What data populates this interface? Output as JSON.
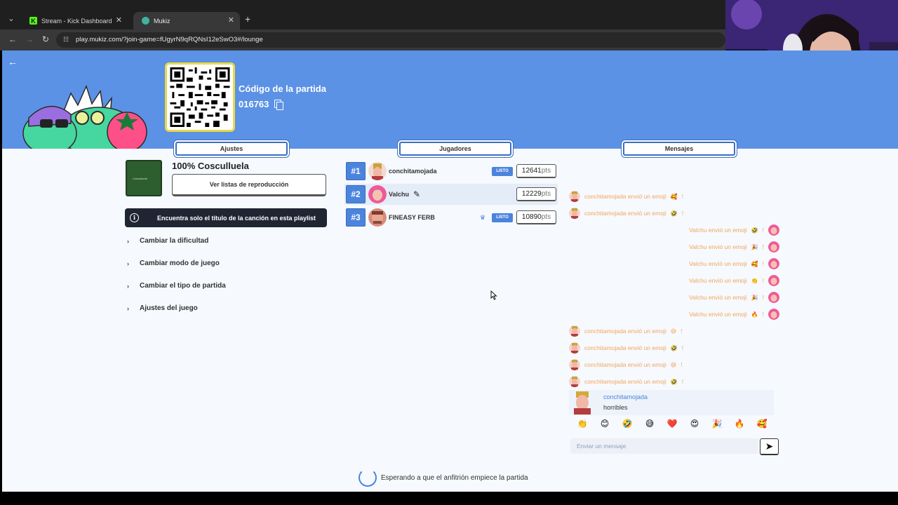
{
  "browser": {
    "tabs": [
      {
        "title": "Stream - Kick Dashboard",
        "favicon": "kick-icon",
        "active": false
      },
      {
        "title": "Mukiz",
        "favicon": "mukiz-icon",
        "active": true
      }
    ],
    "url": "play.mukiz.com/?join-game=fUgyrN9qRQNsI12eSwO3#/lounge"
  },
  "header": {
    "code_title": "Código de la partida",
    "code": "016763"
  },
  "sections": {
    "settings": "Ajustes",
    "players": "Jugadores",
    "messages": "Mensajes"
  },
  "settings": {
    "playlist_title": "100% Cosculluela",
    "playlist_cover_text": "Cosculluela",
    "view_playlists": "Ver listas de reproducción",
    "info": "Encuentra solo el título de la canción en esta playlist",
    "options": [
      "Cambiar la dificultad",
      "Cambiar modo de juego",
      "Cambiar el tipo de partida",
      "Ajustes del juego"
    ]
  },
  "players": [
    {
      "rank": "#1",
      "name": "conchitamojada",
      "ready": "LISTO",
      "points": "12641",
      "unit": "pts",
      "host": false,
      "me": false
    },
    {
      "rank": "#2",
      "name": "Valchu",
      "ready": "",
      "points": "12229",
      "unit": "pts",
      "host": false,
      "me": true
    },
    {
      "rank": "#3",
      "name": "FINEASY FERB",
      "ready": "LISTO",
      "points": "10890",
      "unit": "pts",
      "host": true,
      "me": false
    }
  ],
  "chat": {
    "events": [
      {
        "side": "left",
        "prefix": "conchitamojada envió un emoji",
        "emoji": "🥰",
        "suffix": "!"
      },
      {
        "side": "left",
        "prefix": "conchitamojada envió un emoji",
        "emoji": "🤣",
        "suffix": "!"
      },
      {
        "side": "right",
        "prefix": "Valchu envió un emoji",
        "emoji": "🤣",
        "suffix": "!"
      },
      {
        "side": "right",
        "prefix": "Valchu envió un emoji",
        "emoji": "🎉",
        "suffix": "!"
      },
      {
        "side": "right",
        "prefix": "Valchu envió un emoji",
        "emoji": "🥰",
        "suffix": "!"
      },
      {
        "side": "right",
        "prefix": "Valchu envió un emoji",
        "emoji": "👏",
        "suffix": "!"
      },
      {
        "side": "right",
        "prefix": "Valchu envió un emoji",
        "emoji": "🎉",
        "suffix": "!"
      },
      {
        "side": "right",
        "prefix": "Valchu envió un emoji",
        "emoji": "🔥",
        "suffix": "!"
      },
      {
        "side": "left",
        "prefix": "conchitamojada envió un emoji",
        "emoji": "😅",
        "suffix": "!"
      },
      {
        "side": "left",
        "prefix": "conchitamojada envió un emoji",
        "emoji": "🤣",
        "suffix": "!"
      },
      {
        "side": "left",
        "prefix": "conchitamojada envió un emoji",
        "emoji": "😅",
        "suffix": "!"
      },
      {
        "side": "left",
        "prefix": "conchitamojada envió un emoji",
        "emoji": "🤣",
        "suffix": "!"
      }
    ],
    "last_message": {
      "user": "conchitamojada",
      "text": "horribles"
    },
    "emojis": [
      "👏",
      "😊",
      "🤣",
      "😅",
      "❤️",
      "😍",
      "🎉",
      "🔥",
      "🥰"
    ],
    "input_placeholder": "Enviar un mensaje"
  },
  "status": "Esperando a que el anfitrión empiece la partida",
  "colors": {
    "header_bg": "#5b92e5",
    "accent": "#4b84dd",
    "chat_event": "#f3a55e",
    "page_bg": "#f6f9fd"
  }
}
